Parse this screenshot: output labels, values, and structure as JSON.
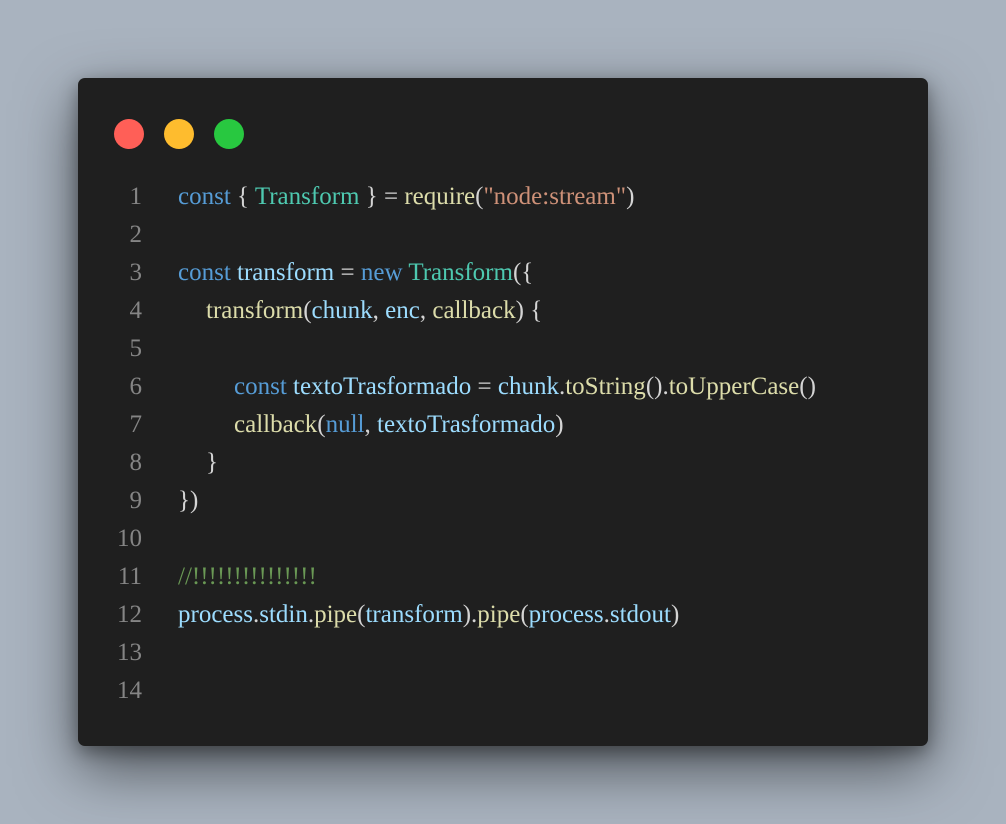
{
  "colors": {
    "background": "#a9b3bf",
    "window": "#1f1f1f",
    "line_number": "#858585",
    "traffic_red": "#ff5f57",
    "traffic_yellow": "#febc2e",
    "traffic_green": "#28c840",
    "keyword": "#569cd6",
    "variable": "#9cdcfe",
    "class": "#4ec9b0",
    "function": "#dcdcaa",
    "string": "#ce9178",
    "punct": "#d4d4d4",
    "comment": "#6a9955"
  },
  "window_controls": [
    {
      "name": "close",
      "color": "#ff5f57",
      "icon": "close-dot-icon"
    },
    {
      "name": "minimize",
      "color": "#febc2e",
      "icon": "minimize-dot-icon"
    },
    {
      "name": "maximize",
      "color": "#28c840",
      "icon": "maximize-dot-icon"
    }
  ],
  "lines": [
    {
      "number": "1",
      "indent": 0,
      "tokens": [
        {
          "t": "const",
          "c": "keyword"
        },
        {
          "t": " { ",
          "c": "punct"
        },
        {
          "t": "Transform",
          "c": "class"
        },
        {
          "t": " } = ",
          "c": "punct"
        },
        {
          "t": "require",
          "c": "function"
        },
        {
          "t": "(",
          "c": "punct"
        },
        {
          "t": "\"node:stream\"",
          "c": "string"
        },
        {
          "t": ")",
          "c": "punct"
        }
      ]
    },
    {
      "number": "2",
      "indent": 0,
      "tokens": []
    },
    {
      "number": "3",
      "indent": 0,
      "tokens": [
        {
          "t": "const",
          "c": "keyword"
        },
        {
          "t": " ",
          "c": "punct"
        },
        {
          "t": "transform",
          "c": "variable"
        },
        {
          "t": " = ",
          "c": "punct"
        },
        {
          "t": "new",
          "c": "keyword"
        },
        {
          "t": " ",
          "c": "punct"
        },
        {
          "t": "Transform",
          "c": "class"
        },
        {
          "t": "({",
          "c": "punct"
        }
      ]
    },
    {
      "number": "4",
      "indent": 1,
      "tokens": [
        {
          "t": "transform",
          "c": "function"
        },
        {
          "t": "(",
          "c": "punct"
        },
        {
          "t": "chunk",
          "c": "variable"
        },
        {
          "t": ", ",
          "c": "punct"
        },
        {
          "t": "enc",
          "c": "variable"
        },
        {
          "t": ", ",
          "c": "punct"
        },
        {
          "t": "callback",
          "c": "function"
        },
        {
          "t": ") {",
          "c": "punct"
        }
      ]
    },
    {
      "number": "5",
      "indent": 0,
      "tokens": []
    },
    {
      "number": "6",
      "indent": 2,
      "tokens": [
        {
          "t": "const",
          "c": "keyword"
        },
        {
          "t": " ",
          "c": "punct"
        },
        {
          "t": "textoTrasformado",
          "c": "variable"
        },
        {
          "t": " = ",
          "c": "punct"
        },
        {
          "t": "chunk",
          "c": "variable"
        },
        {
          "t": ".",
          "c": "punct"
        },
        {
          "t": "toString",
          "c": "function"
        },
        {
          "t": "().",
          "c": "punct"
        },
        {
          "t": "toUpperCase",
          "c": "function"
        },
        {
          "t": "()",
          "c": "punct"
        }
      ]
    },
    {
      "number": "7",
      "indent": 2,
      "tokens": [
        {
          "t": "callback",
          "c": "function"
        },
        {
          "t": "(",
          "c": "punct"
        },
        {
          "t": "null",
          "c": "keyword"
        },
        {
          "t": ", ",
          "c": "punct"
        },
        {
          "t": "textoTrasformado",
          "c": "variable"
        },
        {
          "t": ")",
          "c": "punct"
        }
      ]
    },
    {
      "number": "8",
      "indent": 1,
      "tokens": [
        {
          "t": "}",
          "c": "punct"
        }
      ]
    },
    {
      "number": "9",
      "indent": 0,
      "tokens": [
        {
          "t": "})",
          "c": "punct"
        }
      ]
    },
    {
      "number": "10",
      "indent": 0,
      "tokens": []
    },
    {
      "number": "11",
      "indent": 0,
      "tokens": [
        {
          "t": "//!!!!!!!!!!!!!!!",
          "c": "comment"
        }
      ]
    },
    {
      "number": "12",
      "indent": 0,
      "tokens": [
        {
          "t": "process",
          "c": "variable"
        },
        {
          "t": ".",
          "c": "punct"
        },
        {
          "t": "stdin",
          "c": "variable"
        },
        {
          "t": ".",
          "c": "punct"
        },
        {
          "t": "pipe",
          "c": "function"
        },
        {
          "t": "(",
          "c": "punct"
        },
        {
          "t": "transform",
          "c": "variable"
        },
        {
          "t": ").",
          "c": "punct"
        },
        {
          "t": "pipe",
          "c": "function"
        },
        {
          "t": "(",
          "c": "punct"
        },
        {
          "t": "process",
          "c": "variable"
        },
        {
          "t": ".",
          "c": "punct"
        },
        {
          "t": "stdout",
          "c": "variable"
        },
        {
          "t": ")",
          "c": "punct"
        }
      ]
    },
    {
      "number": "13",
      "indent": 0,
      "tokens": []
    },
    {
      "number": "14",
      "indent": 0,
      "tokens": []
    }
  ]
}
